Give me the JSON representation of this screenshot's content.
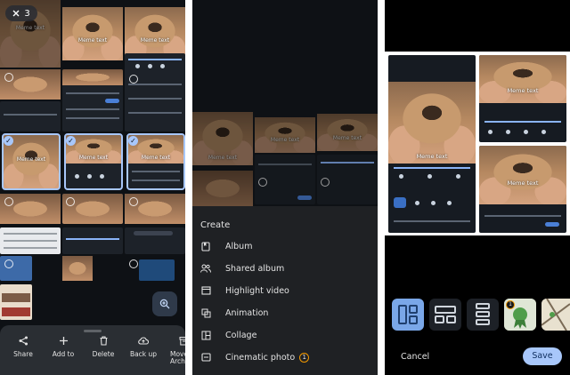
{
  "selection": {
    "count": "3"
  },
  "photos": {
    "meme_text": "Meme text"
  },
  "action_bar": {
    "items": [
      {
        "label": "Share",
        "icon": "share-icon"
      },
      {
        "label": "Add to",
        "icon": "plus-icon"
      },
      {
        "label": "Delete",
        "icon": "trash-icon"
      },
      {
        "label": "Back up",
        "icon": "cloud-upload-icon"
      },
      {
        "label": "Move",
        "label2": "Arch",
        "icon": "archive-icon"
      }
    ]
  },
  "create_menu": {
    "title": "Create",
    "items": [
      {
        "label": "Album",
        "icon": "album-icon"
      },
      {
        "label": "Shared album",
        "icon": "people-icon"
      },
      {
        "label": "Highlight video",
        "icon": "movie-icon"
      },
      {
        "label": "Animation",
        "icon": "animation-icon"
      },
      {
        "label": "Collage",
        "icon": "collage-icon"
      },
      {
        "label": "Cinematic photo",
        "icon": "cinematic-icon",
        "badge": "1"
      }
    ]
  },
  "collage_editor": {
    "layout_badge": "1",
    "cancel_label": "Cancel",
    "save_label": "Save"
  },
  "colors": {
    "background": "#0e1115",
    "sheet": "#1f2124",
    "accent": "#a8c7fa",
    "badge_ring": "#f29900"
  }
}
